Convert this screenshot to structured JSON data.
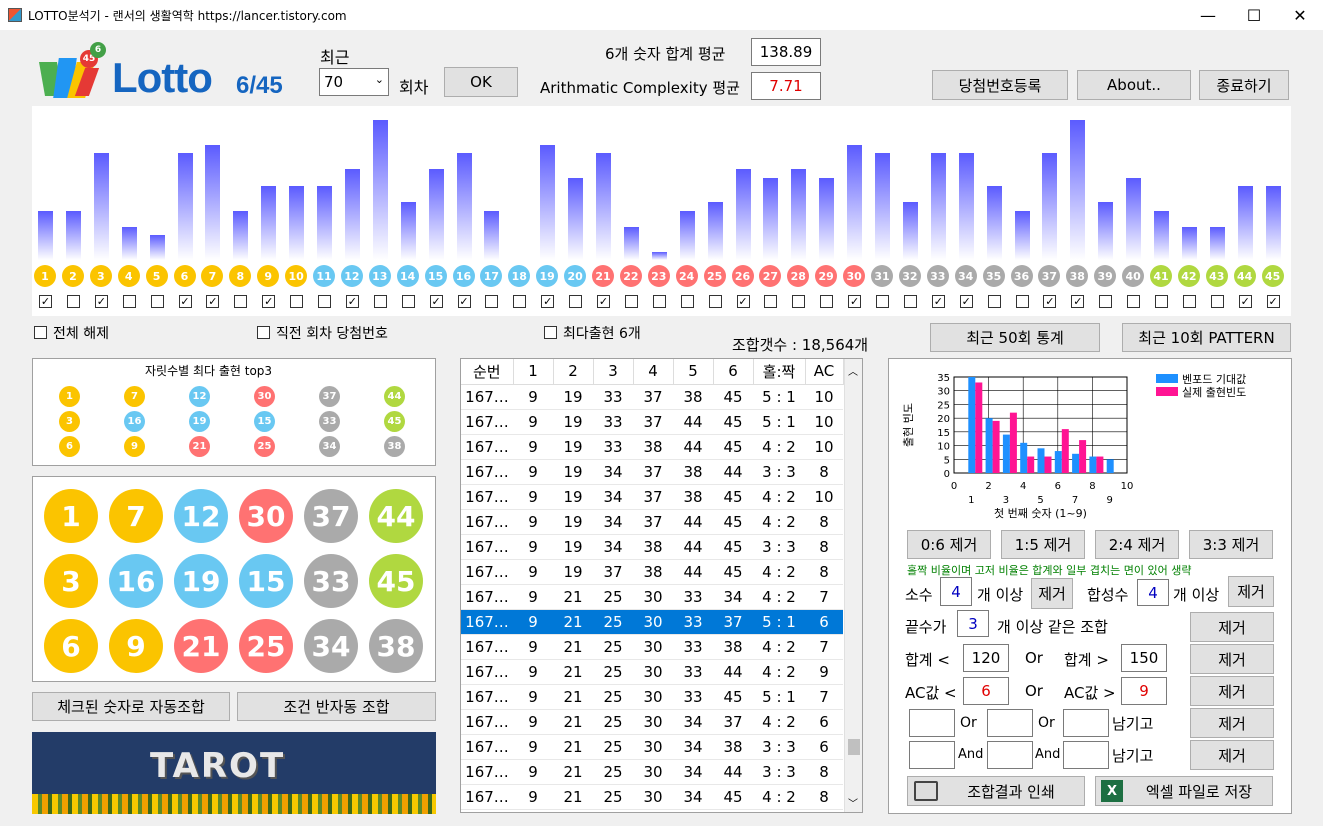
{
  "window": {
    "title": "LOTTO분석기  -  랜서의 생활역학 https://lancer.tistory.com",
    "minimize": "—",
    "maximize": "☐",
    "close": "✕"
  },
  "logo": {
    "word": "Lotto",
    "suffix": "6/45",
    "badge1": "6",
    "badge2": "45"
  },
  "recent": {
    "label": "최근",
    "value": "70",
    "unit": "회차",
    "ok": "OK"
  },
  "stats": {
    "sum_label": "6개 숫자 합계 평균",
    "sum_value": "138.89",
    "ac_label": "Arithmatic Complexity 평균",
    "ac_value": "7.71"
  },
  "buttons": {
    "register": "당첨번호등록",
    "about": "About..",
    "exit": "종료하기",
    "stats50": "최근 50회 통계",
    "pattern10": "최근 10회 PATTERN",
    "auto": "체크된 숫자로 자동조합",
    "semi": "조건 반자동 조합",
    "print": "조합결과 인쇄",
    "excel": "엑셀 파일로 저장"
  },
  "colors": {
    "yellow": "#fbc400",
    "blue": "#69c8f2",
    "red": "#ff7272",
    "gray": "#aaaaaa",
    "green": "#b0d840",
    "bar": "#5b5bff",
    "selection": "#0078d7"
  },
  "freq": [
    6,
    6,
    13,
    4,
    3,
    13,
    14,
    6,
    9,
    9,
    9,
    11,
    17,
    7,
    11,
    13,
    6,
    0,
    14,
    10,
    13,
    4,
    1,
    6,
    7,
    11,
    10,
    11,
    10,
    14,
    13,
    7,
    13,
    13,
    9,
    6,
    13,
    17,
    7,
    10,
    6,
    4,
    4,
    9,
    9
  ],
  "checked": [
    true,
    false,
    true,
    false,
    false,
    true,
    true,
    false,
    true,
    false,
    false,
    true,
    false,
    false,
    true,
    true,
    false,
    false,
    true,
    false,
    true,
    false,
    false,
    false,
    false,
    true,
    false,
    false,
    false,
    true,
    false,
    false,
    true,
    true,
    false,
    false,
    true,
    true,
    false,
    false,
    false,
    false,
    false,
    true,
    true
  ],
  "options": {
    "clear_all": "전체 해제",
    "last_draw": "직전 회차 당첨번호",
    "top6": "최다출현 6개",
    "combo_count": "조합갯수 : 18,564개"
  },
  "top3": {
    "title": "자릿수별 최다 출현 top3",
    "rows": [
      [
        1,
        7,
        12,
        30,
        37,
        44
      ],
      [
        3,
        16,
        19,
        15,
        33,
        45
      ],
      [
        6,
        9,
        21,
        25,
        34,
        38
      ]
    ]
  },
  "table": {
    "headers": [
      "순번",
      "1",
      "2",
      "3",
      "4",
      "5",
      "6",
      "홀:짝",
      "AC"
    ],
    "rows": [
      [
        "167…",
        "9",
        "19",
        "33",
        "37",
        "38",
        "45",
        "5 : 1",
        "10"
      ],
      [
        "167…",
        "9",
        "19",
        "33",
        "37",
        "44",
        "45",
        "5 : 1",
        "10"
      ],
      [
        "167…",
        "9",
        "19",
        "33",
        "38",
        "44",
        "45",
        "4 : 2",
        "10"
      ],
      [
        "167…",
        "9",
        "19",
        "34",
        "37",
        "38",
        "44",
        "3 : 3",
        "8"
      ],
      [
        "167…",
        "9",
        "19",
        "34",
        "37",
        "38",
        "45",
        "4 : 2",
        "10"
      ],
      [
        "167…",
        "9",
        "19",
        "34",
        "37",
        "44",
        "45",
        "4 : 2",
        "8"
      ],
      [
        "167…",
        "9",
        "19",
        "34",
        "38",
        "44",
        "45",
        "3 : 3",
        "8"
      ],
      [
        "167…",
        "9",
        "19",
        "37",
        "38",
        "44",
        "45",
        "4 : 2",
        "8"
      ],
      [
        "167…",
        "9",
        "21",
        "25",
        "30",
        "33",
        "34",
        "4 : 2",
        "7"
      ],
      [
        "167…",
        "9",
        "21",
        "25",
        "30",
        "33",
        "37",
        "5 : 1",
        "6"
      ],
      [
        "167…",
        "9",
        "21",
        "25",
        "30",
        "33",
        "38",
        "4 : 2",
        "7"
      ],
      [
        "167…",
        "9",
        "21",
        "25",
        "30",
        "33",
        "44",
        "4 : 2",
        "9"
      ],
      [
        "167…",
        "9",
        "21",
        "25",
        "30",
        "33",
        "45",
        "5 : 1",
        "7"
      ],
      [
        "167…",
        "9",
        "21",
        "25",
        "30",
        "34",
        "37",
        "4 : 2",
        "6"
      ],
      [
        "167…",
        "9",
        "21",
        "25",
        "30",
        "34",
        "38",
        "3 : 3",
        "6"
      ],
      [
        "167…",
        "9",
        "21",
        "25",
        "30",
        "34",
        "44",
        "3 : 3",
        "8"
      ],
      [
        "167…",
        "9",
        "21",
        "25",
        "30",
        "34",
        "45",
        "4 : 2",
        "8"
      ]
    ],
    "selected_index": 9
  },
  "chart_data": {
    "type": "bar",
    "categories": [
      "1",
      "2",
      "3",
      "4",
      "5",
      "6",
      "7",
      "8",
      "9"
    ],
    "series": [
      {
        "name": "벤포드 기대값",
        "values": [
          35,
          20,
          14,
          11,
          9,
          8,
          7,
          6,
          5
        ]
      },
      {
        "name": "실제 출현빈도",
        "values": [
          33,
          19,
          22,
          6,
          6,
          16,
          12,
          6,
          0
        ]
      }
    ],
    "xlabel": "첫 번째 숫자 (1~9)",
    "ylabel": "출현 빈도",
    "ylim": [
      0,
      35
    ],
    "xlim": [
      0,
      10
    ],
    "yticks": [
      "35",
      "30",
      "25",
      "20",
      "15",
      "10",
      "5",
      "0"
    ],
    "xticks": [
      "0",
      "2",
      "4",
      "6",
      "8",
      "10"
    ],
    "xticks2": [
      "1",
      "3",
      "5",
      "7",
      "9"
    ],
    "legend": "top-right"
  },
  "filters": {
    "r06": "0:6 제거",
    "r15": "1:5 제거",
    "r24": "2:4 제거",
    "r33": "3:3 제거",
    "note": "홀짝 비율이며 고저 비율은 합계와 일부 겹치는 면이 있어 생략",
    "prime_label": "소수",
    "prime_value": "4",
    "prime_unit": "개 이상",
    "remove": "제거",
    "comp_label": "합성수",
    "comp_value": "4",
    "comp_unit": "개 이상",
    "end_label": "끝수가",
    "end_value": "3",
    "end_unit": "개 이상 같은 조합",
    "sum_lt": "합계 <",
    "sum_lt_val": "120",
    "or": "Or",
    "sum_gt": "합계 >",
    "sum_gt_val": "150",
    "ac_lt": "AC값 <",
    "ac_lt_val": "6",
    "ac_gt": "AC값 >",
    "ac_gt_val": "9",
    "leave": "남기고",
    "and": "And"
  },
  "banner": {
    "text": "TAROT"
  }
}
